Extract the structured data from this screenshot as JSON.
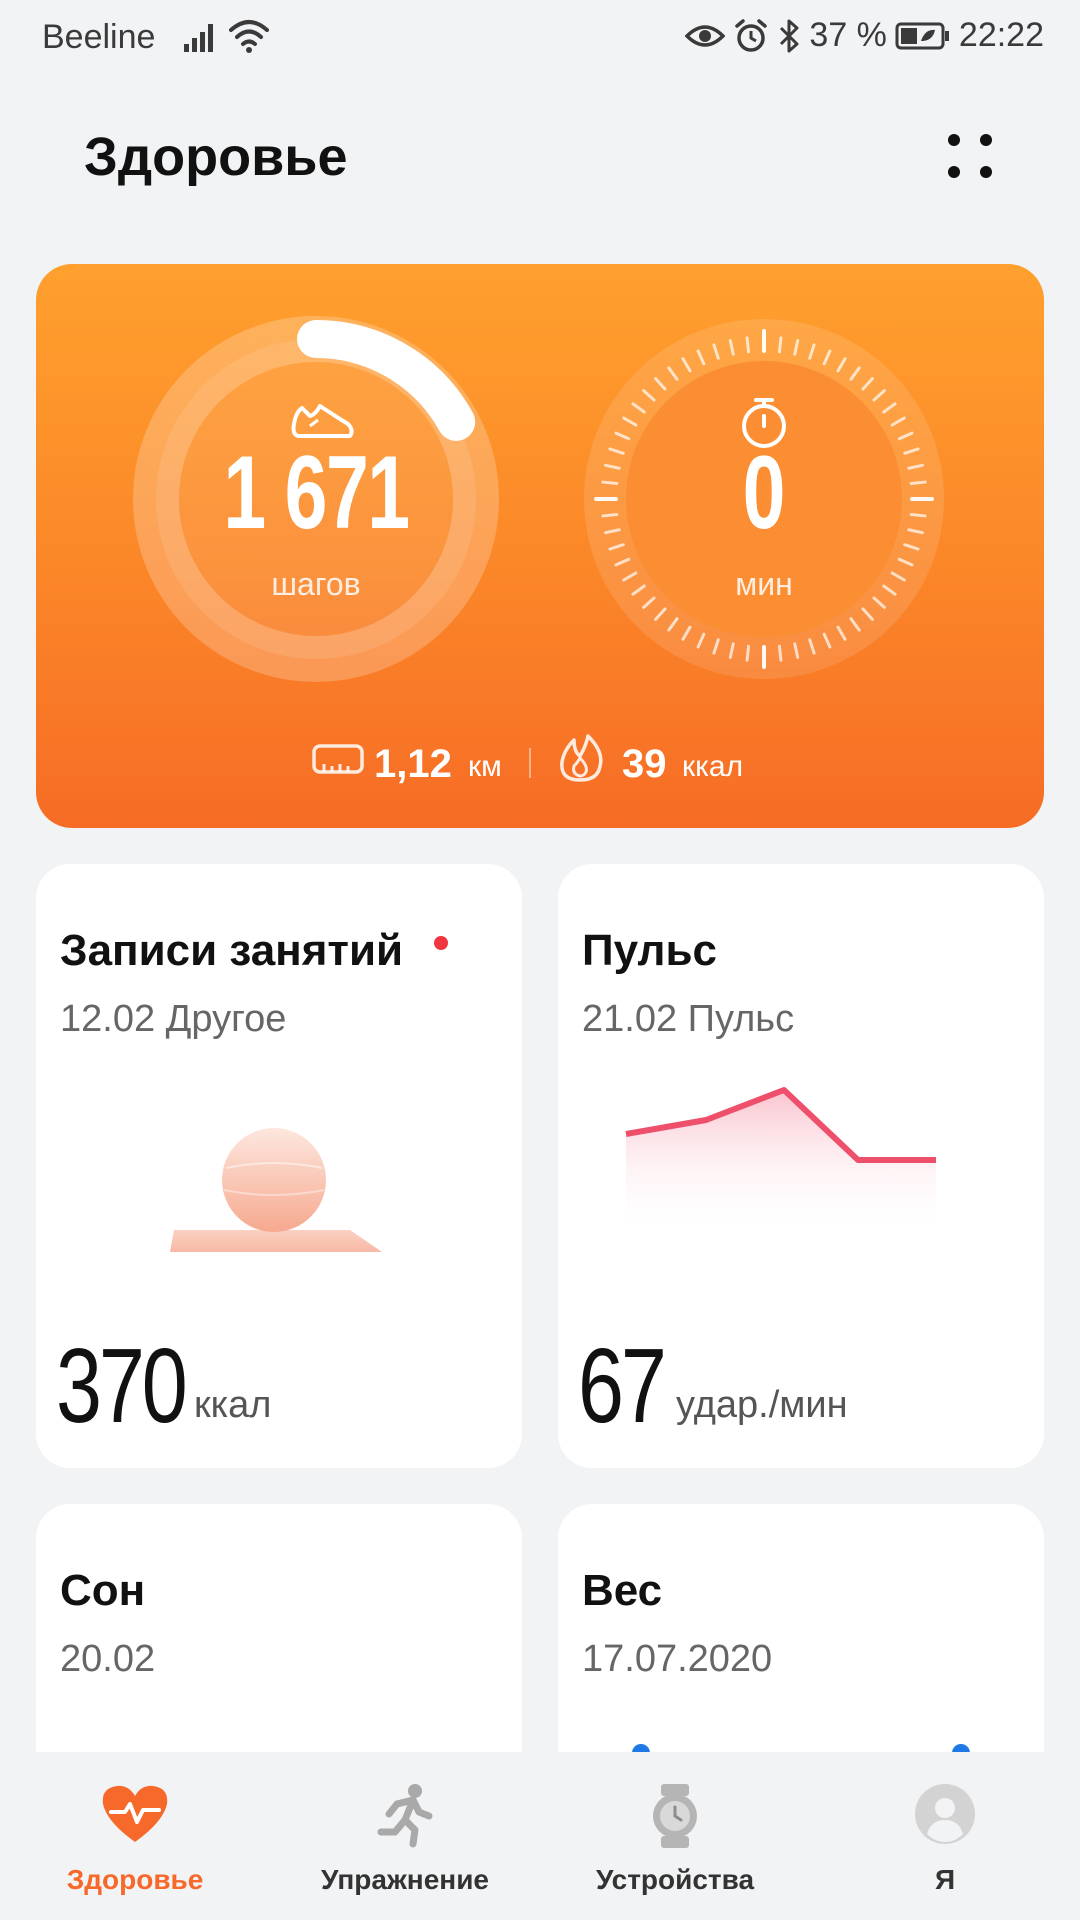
{
  "status_bar": {
    "carrier": "Beeline",
    "battery": "37 %",
    "time": "22:22"
  },
  "header": {
    "title": "Здоровье"
  },
  "activity": {
    "steps_value": "1 671",
    "steps_unit": "шагов",
    "steps_progress_fraction": 0.17,
    "minutes_value": "0",
    "minutes_unit": "мин",
    "distance_value": "1,12",
    "distance_unit": "км",
    "calories_value": "39",
    "calories_unit": "ккал",
    "colors": {
      "gradient_top": "#ffa02e",
      "gradient_bottom": "#f66c25"
    }
  },
  "tiles": {
    "workouts": {
      "title": "Записи занятий",
      "subtitle": "12.02 Другое",
      "value": "370",
      "unit": "ккал",
      "badge_color": "#f0363e"
    },
    "pulse": {
      "title": "Пульс",
      "subtitle": "21.02 Пульс",
      "value": "67",
      "unit": "удар./мин",
      "line_color": "#ee4f6b"
    },
    "sleep": {
      "title": "Сон",
      "subtitle": "20.02"
    },
    "weight": {
      "title": "Вес",
      "subtitle": "17.07.2020"
    }
  },
  "bottom_nav": {
    "items": [
      {
        "label": "Здоровье",
        "icon": "heart-pulse-icon",
        "active": true
      },
      {
        "label": "Упражнение",
        "icon": "running-icon",
        "active": false
      },
      {
        "label": "Устройства",
        "icon": "watch-icon",
        "active": false
      },
      {
        "label": "Я",
        "icon": "avatar-icon",
        "active": false
      }
    ],
    "active_color": "#f7692b"
  }
}
